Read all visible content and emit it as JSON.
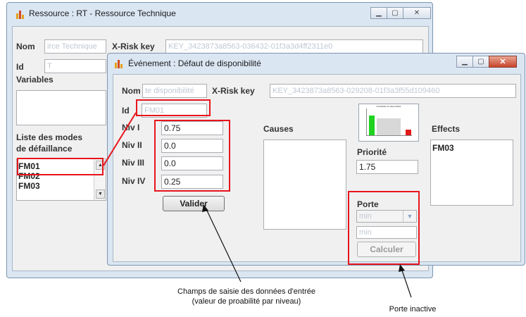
{
  "win1": {
    "title": "Ressource : RT - Ressource Technique",
    "nom_label": "Nom",
    "nom_value": "irce Technique",
    "xrisk_label": "X-Risk key",
    "xrisk_value": "KEY_3423873a8563-036432-01f3a3d4ff2311e0",
    "id_label": "Id",
    "id_value": "T",
    "variables_label": "Variables",
    "modes_label_1": "Liste des modes",
    "modes_label_2": "de défaillance",
    "modes": [
      "FM01",
      "FM02",
      "FM03"
    ]
  },
  "win2": {
    "title": "Événement : Défaut de disponibilité",
    "nom_label": "Nom",
    "nom_value": "te disponibilité",
    "xrisk_label": "X-Risk key",
    "xrisk_value": "KEY_3423873a8563-029208-01f3a3f55d109460",
    "id_label": "Id",
    "id_value": "FM01",
    "niv_labels": [
      "Niv I",
      "Niv II",
      "Niv III",
      "Niv IV"
    ],
    "niv_values": [
      "0.75",
      "0.0",
      "0.0",
      "0.25"
    ],
    "valider_label": "Valider",
    "causes_label": "Causes",
    "effects_label": "Effects",
    "effects_items": [
      "FM03"
    ],
    "priorite_label": "Priorité",
    "priorite_value": "1.75",
    "porte_label": "Porte",
    "porte_select": "min",
    "porte_field": "min",
    "calculer_label": "Calculer",
    "thumb_title": "Probabilité de disponibilité"
  },
  "annotations": {
    "inputs_line1": "Champs de saisie des données d'entrée",
    "inputs_line2": "(valeur de proabilité par niveau)",
    "gate": "Porte inactive"
  },
  "colors": {
    "highlight": "#e8141c",
    "bar_green": "#1fd21f",
    "bar_red": "#e31a1a"
  },
  "icons": {
    "app": "bar-chart-icon",
    "minimize": "minimize-icon",
    "maximize": "maximize-icon",
    "close": "close-icon"
  }
}
